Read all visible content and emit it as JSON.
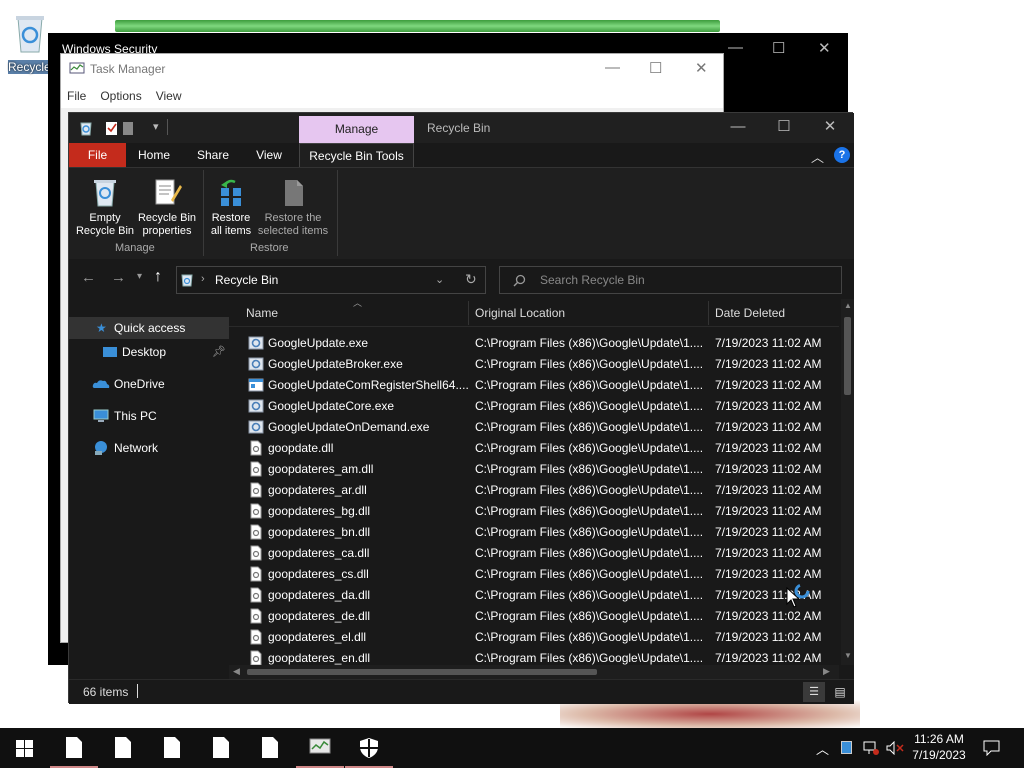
{
  "desktop": {
    "recycle_label": "Recycle"
  },
  "windows_security": {
    "title": "Windows Security"
  },
  "task_manager": {
    "title": "Task Manager",
    "menu": [
      "File",
      "Options",
      "View"
    ]
  },
  "explorer": {
    "manage_tab": "Manage",
    "title": "Recycle Bin",
    "ribbon_tabs": {
      "file": "File",
      "home": "Home",
      "share": "Share",
      "view": "View",
      "tools": "Recycle Bin Tools"
    },
    "ribbon": {
      "empty": "Empty\nRecycle Bin",
      "properties": "Recycle Bin\nproperties",
      "restore_all": "Restore\nall items",
      "restore_selected": "Restore the\nselected items",
      "group_manage": "Manage",
      "group_restore": "Restore"
    },
    "address": {
      "path": "Recycle Bin"
    },
    "search": {
      "placeholder": "Search Recycle Bin"
    },
    "nav": {
      "quick_access": "Quick access",
      "desktop": "Desktop",
      "onedrive": "OneDrive",
      "this_pc": "This PC",
      "network": "Network"
    },
    "columns": {
      "name": "Name",
      "location": "Original Location",
      "date": "Date Deleted"
    },
    "files": [
      {
        "name": "GoogleUpdate.exe",
        "type": "exe",
        "location": "C:\\Program Files (x86)\\Google\\Update\\1....",
        "date": "7/19/2023 11:02 AM"
      },
      {
        "name": "GoogleUpdateBroker.exe",
        "type": "exe",
        "location": "C:\\Program Files (x86)\\Google\\Update\\1....",
        "date": "7/19/2023 11:02 AM"
      },
      {
        "name": "GoogleUpdateComRegisterShell64....",
        "type": "app",
        "location": "C:\\Program Files (x86)\\Google\\Update\\1....",
        "date": "7/19/2023 11:02 AM"
      },
      {
        "name": "GoogleUpdateCore.exe",
        "type": "exe",
        "location": "C:\\Program Files (x86)\\Google\\Update\\1....",
        "date": "7/19/2023 11:02 AM"
      },
      {
        "name": "GoogleUpdateOnDemand.exe",
        "type": "exe",
        "location": "C:\\Program Files (x86)\\Google\\Update\\1....",
        "date": "7/19/2023 11:02 AM"
      },
      {
        "name": "goopdate.dll",
        "type": "dll",
        "location": "C:\\Program Files (x86)\\Google\\Update\\1....",
        "date": "7/19/2023 11:02 AM"
      },
      {
        "name": "goopdateres_am.dll",
        "type": "dll",
        "location": "C:\\Program Files (x86)\\Google\\Update\\1....",
        "date": "7/19/2023 11:02 AM"
      },
      {
        "name": "goopdateres_ar.dll",
        "type": "dll",
        "location": "C:\\Program Files (x86)\\Google\\Update\\1....",
        "date": "7/19/2023 11:02 AM"
      },
      {
        "name": "goopdateres_bg.dll",
        "type": "dll",
        "location": "C:\\Program Files (x86)\\Google\\Update\\1....",
        "date": "7/19/2023 11:02 AM"
      },
      {
        "name": "goopdateres_bn.dll",
        "type": "dll",
        "location": "C:\\Program Files (x86)\\Google\\Update\\1....",
        "date": "7/19/2023 11:02 AM"
      },
      {
        "name": "goopdateres_ca.dll",
        "type": "dll",
        "location": "C:\\Program Files (x86)\\Google\\Update\\1....",
        "date": "7/19/2023 11:02 AM"
      },
      {
        "name": "goopdateres_cs.dll",
        "type": "dll",
        "location": "C:\\Program Files (x86)\\Google\\Update\\1....",
        "date": "7/19/2023 11:02 AM"
      },
      {
        "name": "goopdateres_da.dll",
        "type": "dll",
        "location": "C:\\Program Files (x86)\\Google\\Update\\1....",
        "date": "7/19/2023 11:02 AM"
      },
      {
        "name": "goopdateres_de.dll",
        "type": "dll",
        "location": "C:\\Program Files (x86)\\Google\\Update\\1....",
        "date": "7/19/2023 11:02 AM"
      },
      {
        "name": "goopdateres_el.dll",
        "type": "dll",
        "location": "C:\\Program Files (x86)\\Google\\Update\\1....",
        "date": "7/19/2023 11:02 AM"
      },
      {
        "name": "goopdateres_en.dll",
        "type": "dll",
        "location": "C:\\Program Files (x86)\\Google\\Update\\1....",
        "date": "7/19/2023 11:02 AM"
      }
    ],
    "status": {
      "count": "66 items"
    }
  },
  "taskbar": {
    "time": "11:26 AM",
    "date": "7/19/2023"
  },
  "colors": {
    "file_tab": "#c42b1c",
    "manage_tab": "#e6c6f0",
    "dark_bg": "#191919",
    "taskbar": "#101010"
  }
}
